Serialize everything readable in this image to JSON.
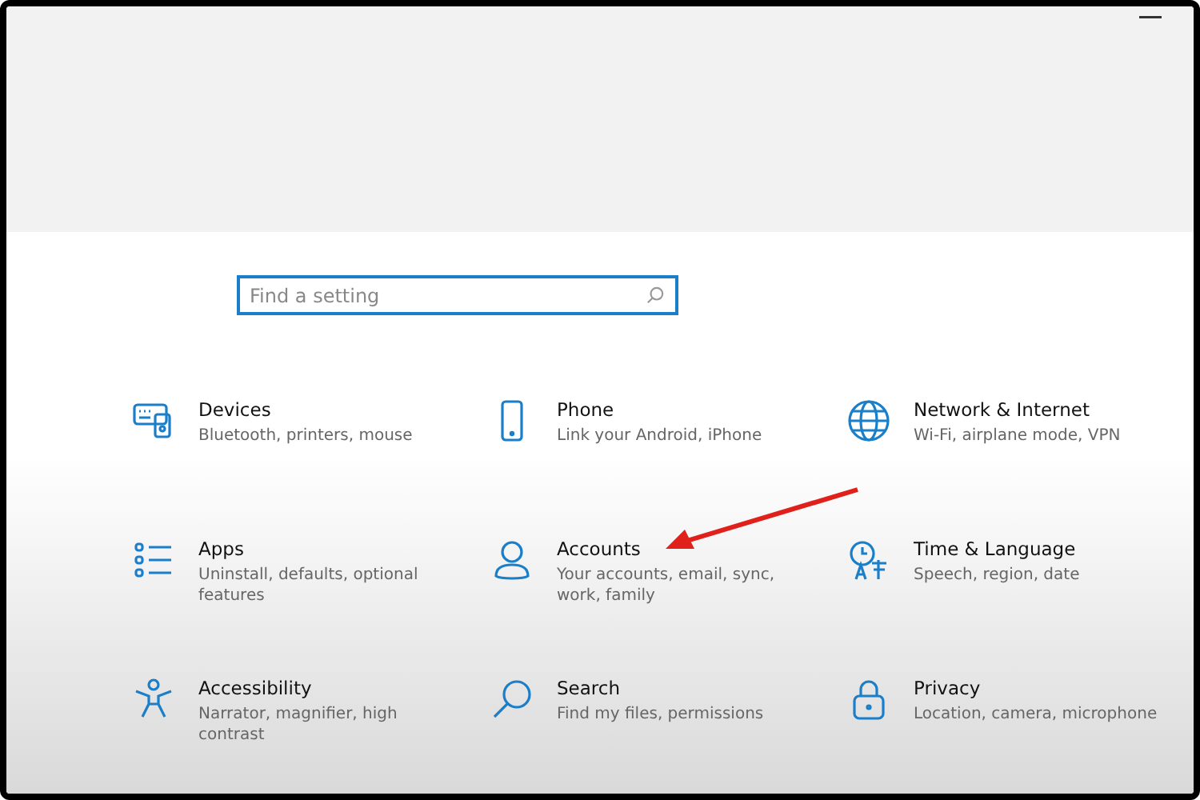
{
  "search": {
    "placeholder": "Find a setting"
  },
  "categories": [
    {
      "title": "Devices",
      "description": "Bluetooth, printers, mouse"
    },
    {
      "title": "Phone",
      "description": "Link your Android, iPhone"
    },
    {
      "title": "Network & Internet",
      "description": "Wi-Fi, airplane mode, VPN"
    },
    {
      "title": "Apps",
      "description": "Uninstall, defaults, optional features"
    },
    {
      "title": "Accounts",
      "description": "Your accounts, email, sync, work, family"
    },
    {
      "title": "Time & Language",
      "description": "Speech, region, date"
    },
    {
      "title": "Accessibility",
      "description": "Narrator, magnifier, high contrast"
    },
    {
      "title": "Search",
      "description": "Find my files, permissions"
    },
    {
      "title": "Privacy",
      "description": "Location, camera, microphone"
    }
  ]
}
